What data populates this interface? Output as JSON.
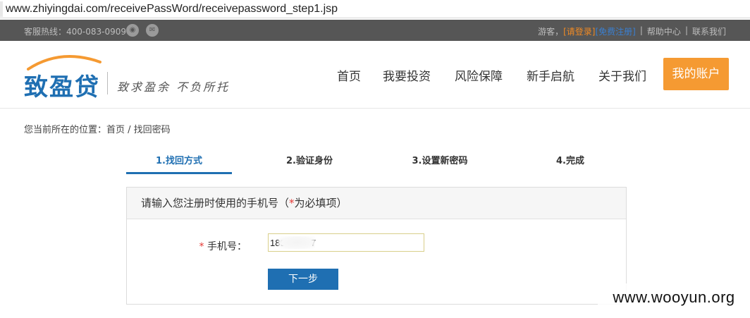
{
  "browser": {
    "url": "www.zhiyingdai.com/receivePassWord/receivepassword_step1.jsp"
  },
  "topbar": {
    "hotline": "客服热线：400-083-0909",
    "weibo_icon": "weibo-icon",
    "wechat_icon": "wechat-icon",
    "guest": "游客，",
    "login": "[请登录]",
    "register": "[免费注册]",
    "help": "帮助中心",
    "contact": "联系我们",
    "separator": "|"
  },
  "header": {
    "logo_text": "致盈贷",
    "slogan": "致求盈余 不负所托",
    "nav": [
      "首页",
      "我要投资",
      "风险保障",
      "新手启航",
      "关于我们"
    ],
    "account_button": "我的账户"
  },
  "breadcrumb": "您当前所在的位置：首页 / 找回密码",
  "steps": [
    "1.找回方式",
    "2.验证身份",
    "3.设置新密码",
    "4.完成"
  ],
  "form": {
    "heading_prefix": "请输入您注册时使用的手机号（",
    "heading_required_mark": "*",
    "heading_suffix": "为必填项）",
    "phone_required_mark": "*",
    "phone_label": " 手机号：",
    "phone_value": "1893        7",
    "next_button": "下一步"
  },
  "watermark": "www.wooyun.org",
  "colors": {
    "brand_blue": "#1f6fb2",
    "account_orange": "#f59a32",
    "topbar_bg": "#565656",
    "login_link": "#f08a24",
    "register_link": "#3a7fd0"
  }
}
